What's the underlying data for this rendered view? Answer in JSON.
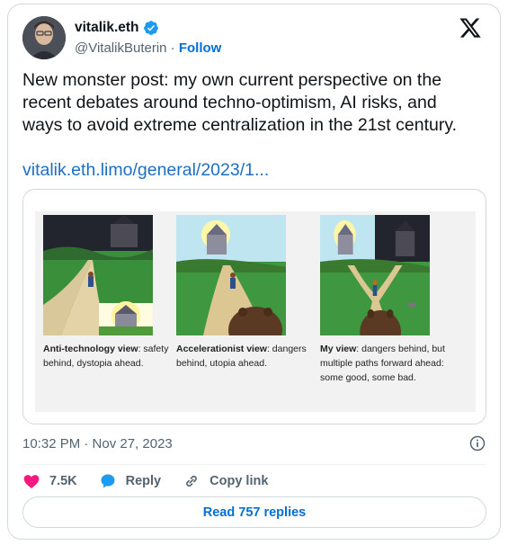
{
  "author": {
    "name": "vitalik.eth",
    "handle": "@VitalikButerin",
    "separator": "·",
    "follow_label": "Follow"
  },
  "post": {
    "text": "New monster post: my own current perspective on the recent debates around techno-optimism, AI risks, and ways to avoid extreme centralization in the 21st century.",
    "link": "vitalik.eth.limo/general/2023/1..."
  },
  "media": {
    "panels": [
      {
        "title": "Anti-technology view",
        "desc": ": safety behind, dystopia ahead."
      },
      {
        "title": "Accelerationist view",
        "desc": ": dangers behind, utopia ahead."
      },
      {
        "title": "My view",
        "desc": ": dangers behind, but multiple paths forward ahead: some good, some bad."
      }
    ]
  },
  "meta": {
    "timestamp": "10:32 PM · Nov 27, 2023"
  },
  "actions": {
    "likes": "7.5K",
    "reply_label": "Reply",
    "copy_label": "Copy link"
  },
  "read_replies_label": "Read 757 replies",
  "colors": {
    "accent": "#006fd6",
    "like": "#f91880",
    "reply": "#1d9bf0",
    "muted": "#536471",
    "border": "#cfd9de"
  }
}
